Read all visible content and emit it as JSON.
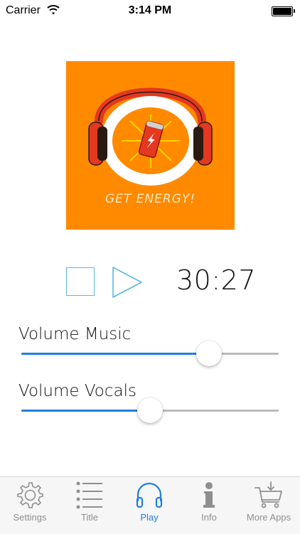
{
  "status_bar": {
    "carrier": "Carrier",
    "time": "3:14 PM"
  },
  "artwork": {
    "text": "GET ENERGY!"
  },
  "player": {
    "timer": "30:27"
  },
  "sliders": {
    "music": {
      "label": "Volume Music",
      "level": 0.73
    },
    "vocals": {
      "label": "Volume Vocals",
      "level": 0.5
    }
  },
  "tabs": [
    {
      "label": "Settings",
      "icon": "gear-icon"
    },
    {
      "label": "Title",
      "icon": "list-icon"
    },
    {
      "label": "Play",
      "icon": "headphones-icon",
      "active": true
    },
    {
      "label": "Info",
      "icon": "info-icon"
    },
    {
      "label": "More Apps",
      "icon": "cart-icon"
    }
  ],
  "colors": {
    "accent": "#1f7fe0",
    "artwork_bg": "#ff8a00",
    "player_controls": "#5ab7e6"
  }
}
